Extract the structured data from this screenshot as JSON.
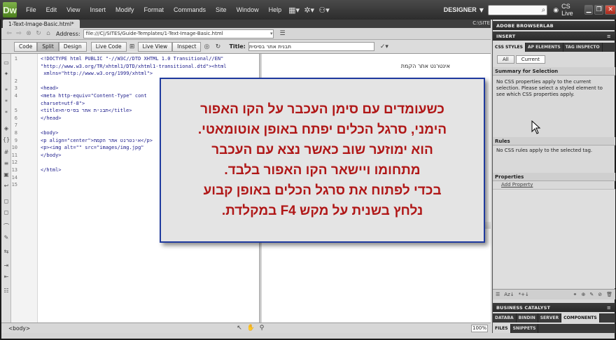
{
  "app": {
    "logo": "Dw",
    "menu": [
      "File",
      "Edit",
      "View",
      "Insert",
      "Modify",
      "Format",
      "Commands",
      "Site",
      "Window",
      "Help"
    ],
    "workspace": "DESIGNER",
    "cs_live": "CS Live"
  },
  "document": {
    "tab": "1-Text-Image-Basic.html*",
    "path_short": "C:\\SITE",
    "address_label": "Address:",
    "address_value": "file:///C|/SITES/Guide-Templates/1-Text-Image-Basic.html",
    "title_label": "Title:",
    "title_value": "תבנית אתר בסיסית",
    "status_tag": "<body>",
    "zoom": "100%"
  },
  "toolbar": {
    "code": "Code",
    "split": "Split",
    "design": "Design",
    "live_code": "Live Code",
    "live_view": "Live View",
    "inspect": "Inspect"
  },
  "code": {
    "line_numbers": [
      "1",
      "",
      "",
      "2",
      "3",
      "4",
      "5",
      "",
      "6",
      "7",
      "8",
      "9",
      "10",
      "11",
      "12",
      "13",
      "14",
      "15"
    ],
    "lines": [
      "<!DOCTYPE html PUBLIC \"-//W3C//DTD XHTML 1.0 Transitional//EN\"",
      "\"http://www.w3.org/TR/xhtml1/DTD/xhtml1-transitional.dtd\"><html",
      " xmlns=\"http://www.w3.org/1999/xhtml\">",
      "",
      "<head>",
      "<meta http-equiv=\"Content-Type\" cont",
      "charset=utf-8\">",
      "<title>תבנית אתר בסיסית</title>",
      "</head>",
      "",
      "<body>",
      "<p align=\"center\">אינטרנט אתר הקמת</p>",
      "<p><img alt=\"\" src=\"images/img.jpg\"",
      "</body>",
      "",
      "</html>"
    ]
  },
  "design": {
    "heading": "אינטרנט אתר הקמת"
  },
  "panels": {
    "browserlab": "ADOBE BROWSERLAB",
    "insert": "INSERT",
    "css_tabs": [
      "CSS STYLES",
      "AP ELEMENTS",
      "TAG INSPECTO"
    ],
    "all": "All",
    "current": "Current",
    "summary_head": "Summary for Selection",
    "summary_text": "No CSS properties apply to the current selection.  Please select a styled element to see which CSS properties apply.",
    "rules_head": "Rules",
    "rules_text": "No CSS rules apply to the selected tag.",
    "properties_head": "Properties",
    "add_property": "Add Property",
    "business_catalyst": "BUSINESS CATALYST",
    "db_tabs": [
      "DATABA",
      "BINDIN",
      "SERVER",
      "COMPONENTS"
    ],
    "files_tabs": [
      "FILES",
      "SNIPPETS"
    ]
  },
  "overlay": {
    "lines": [
      "כשעומדים עם סימן העכבר על הקו האפור",
      "הימני, סרגל הכלים יפתח באופן אוטומאטי.",
      "הוא ימוזער שוב כאשר נצא עם העכבר",
      "מתחומו ויישאר הקו האפור בלבד.",
      "בכדי לפתוח את סרגל הכלים באופן קבוע",
      "נלחץ בשנית על מקש F4 במקלדת."
    ]
  },
  "colors": {
    "overlay_text": "#b01717",
    "overlay_border": "#1f3a9e",
    "logo": "#5e9a2c"
  }
}
